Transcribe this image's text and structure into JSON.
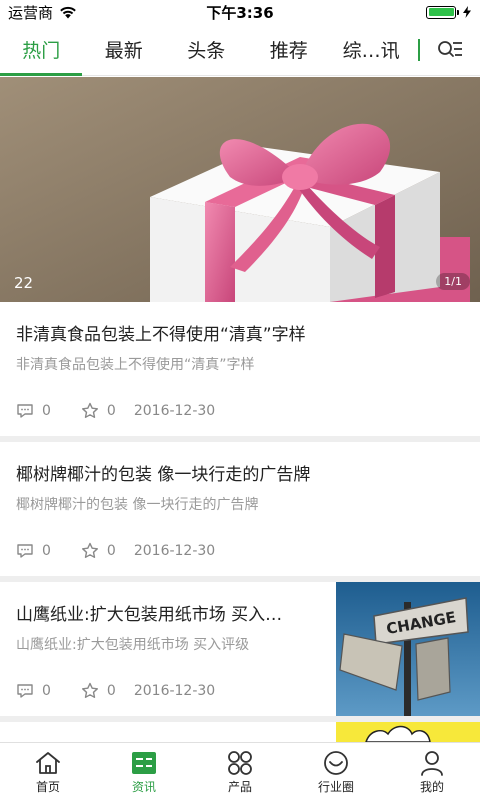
{
  "status_bar": {
    "carrier": "运营商",
    "time": "下午3:36",
    "battery_level": 1.0,
    "battery_color": "#2fc24a"
  },
  "tabs": [
    {
      "label": "热门",
      "active": true
    },
    {
      "label": "最新",
      "active": false
    },
    {
      "label": "头条",
      "active": false
    },
    {
      "label": "推荐",
      "active": false
    },
    {
      "label": "综…讯",
      "active": false
    }
  ],
  "banner": {
    "caption": "22",
    "pager": "1/1"
  },
  "articles": [
    {
      "title": "非清真食品包装上不得使用“清真”字样",
      "summary": "非清真食品包装上不得使用“清真”字样",
      "comments": "0",
      "likes": "0",
      "date": "2016-12-30"
    },
    {
      "title": "椰树牌椰汁的包装 像一块行走的广告牌",
      "summary": "椰树牌椰汁的包装 像一块行走的广告牌",
      "comments": "0",
      "likes": "0",
      "date": "2016-12-30"
    },
    {
      "title": "山鹰纸业:扩大包装用纸市场 买入…",
      "summary": "山鹰纸业:扩大包装用纸市场 买入评级",
      "comments": "0",
      "likes": "0",
      "date": "2016-12-30",
      "thumb_sign_text": "CHANGE"
    }
  ],
  "bottom_nav": [
    {
      "label": "首页",
      "icon": "home-icon",
      "active": false
    },
    {
      "label": "资讯",
      "icon": "news-icon",
      "active": true
    },
    {
      "label": "产品",
      "icon": "grid-icon",
      "active": false
    },
    {
      "label": "行业圈",
      "icon": "smile-icon",
      "active": false
    },
    {
      "label": "我的",
      "icon": "person-icon",
      "active": false
    }
  ],
  "colors": {
    "accent": "#2c9e45",
    "ribbon": "#e0608e",
    "muted_text": "#9a9a9a"
  }
}
